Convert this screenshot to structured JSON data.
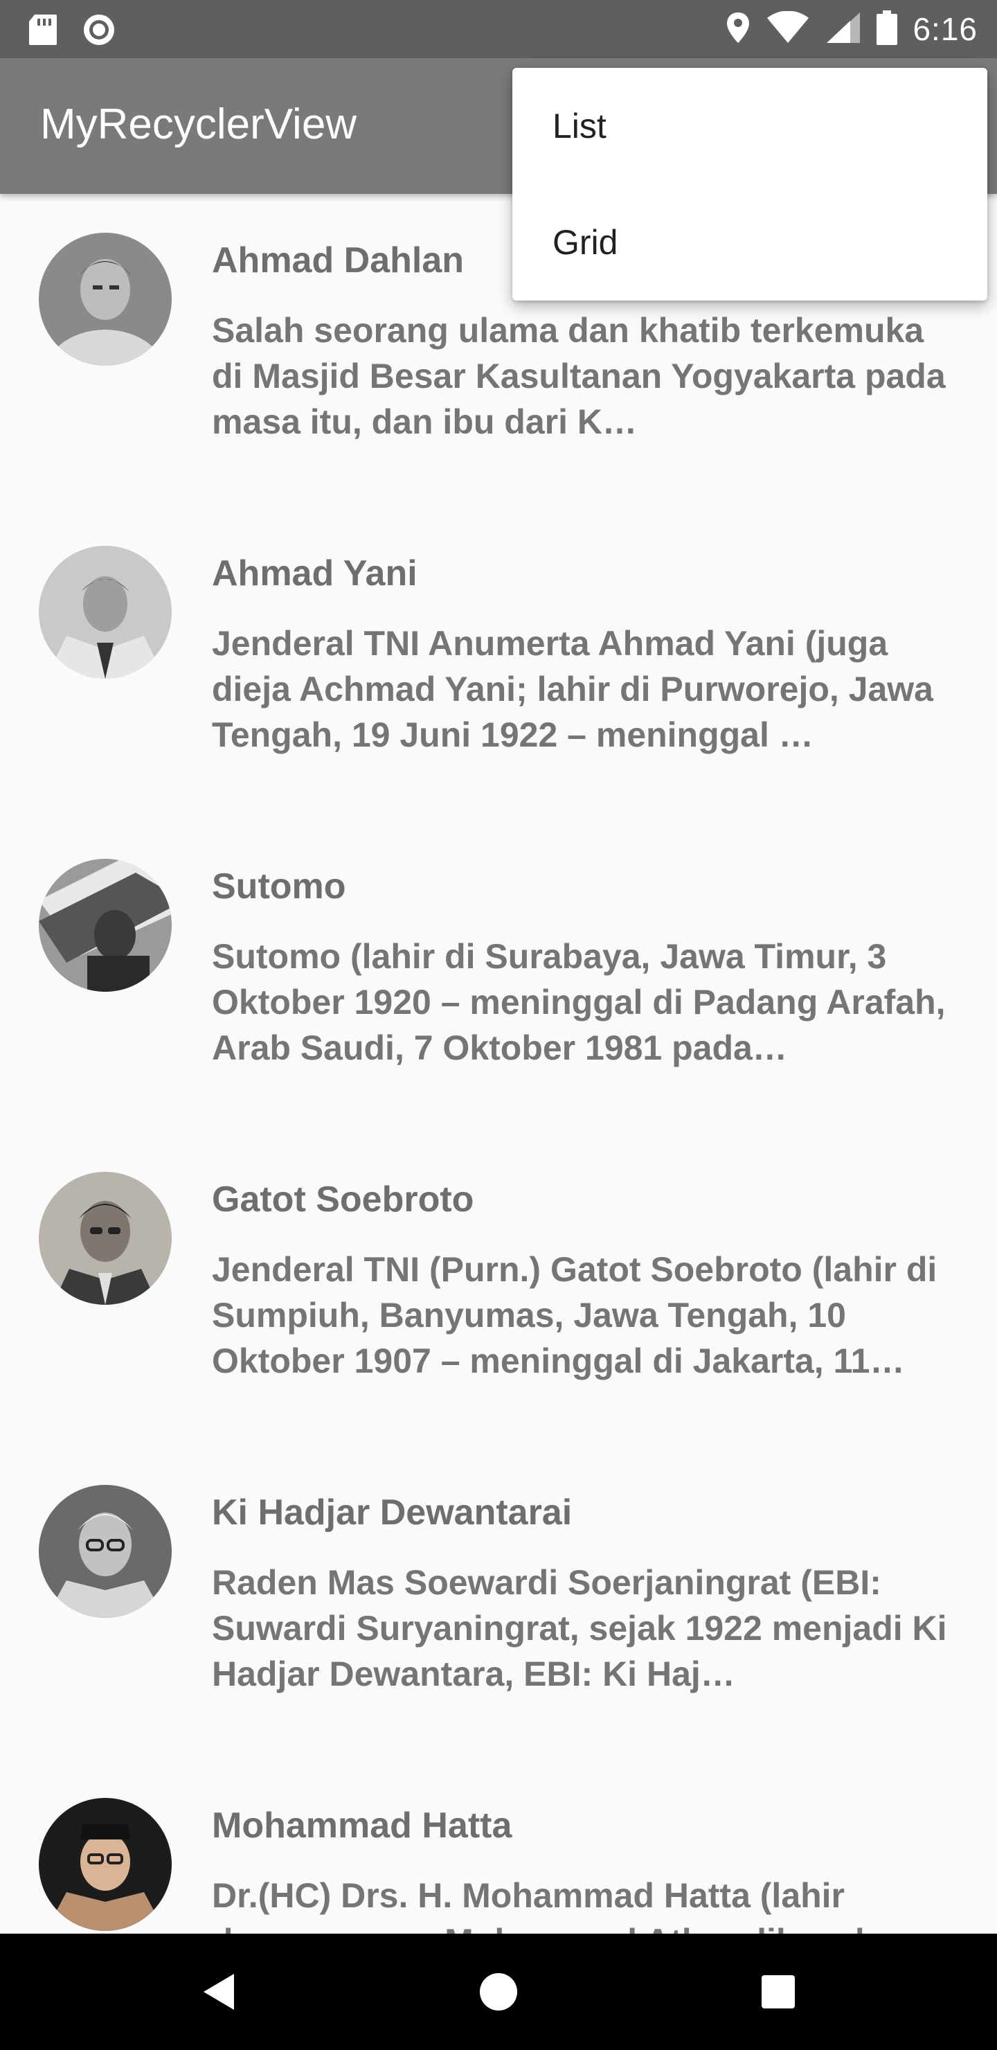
{
  "status_bar": {
    "time": "6:16",
    "icons": [
      "sd-card-icon",
      "record-icon",
      "location-icon",
      "wifi-icon",
      "signal-icon",
      "battery-icon"
    ]
  },
  "app_bar": {
    "title": "MyRecyclerView"
  },
  "menu": {
    "items": [
      {
        "label": "List"
      },
      {
        "label": "Grid"
      }
    ]
  },
  "list": {
    "items": [
      {
        "name": "Ahmad Dahlan",
        "description": "Salah seorang ulama dan khatib terkemuka di Masjid Besar Kasultanan Yogyakarta pada masa itu, dan ibu dari K…",
        "avatar_tone": "#8a8a8a"
      },
      {
        "name": "Ahmad Yani",
        "description": "Jenderal TNI Anumerta Ahmad Yani (juga dieja Achmad Yani; lahir di Purworejo, Jawa Tengah, 19 Juni 1922 – meninggal …",
        "avatar_tone": "#c9c9c9"
      },
      {
        "name": "Sutomo",
        "description": "Sutomo (lahir di Surabaya, Jawa Timur, 3 Oktober 1920 – meninggal di Padang Arafah, Arab Saudi, 7 Oktober 1981 pada…",
        "avatar_tone": "#9a9a9a"
      },
      {
        "name": "Gatot Soebroto",
        "description": "Jenderal TNI (Purn.) Gatot Soebroto (lahir di Sumpiuh, Banyumas, Jawa Tengah, 10 Oktober 1907 – meninggal di Jakarta, 11…",
        "avatar_tone": "#b8b3ad"
      },
      {
        "name": "Ki Hadjar Dewantarai",
        "description": "Raden Mas Soewardi Soerjaningrat (EBI: Suwardi Suryaningrat, sejak 1922 menjadi Ki Hadjar Dewantara, EBI: Ki Haj…",
        "avatar_tone": "#6a6a6a"
      },
      {
        "name": "Mohammad Hatta",
        "description": "Dr.(HC) Drs. H. Mohammad Hatta (lahir dengan nama Mohammad Athar dikenal…",
        "avatar_tone": "#b89070"
      }
    ]
  },
  "nav_bar": {
    "buttons": [
      "back-icon",
      "home-icon",
      "recents-icon"
    ]
  }
}
